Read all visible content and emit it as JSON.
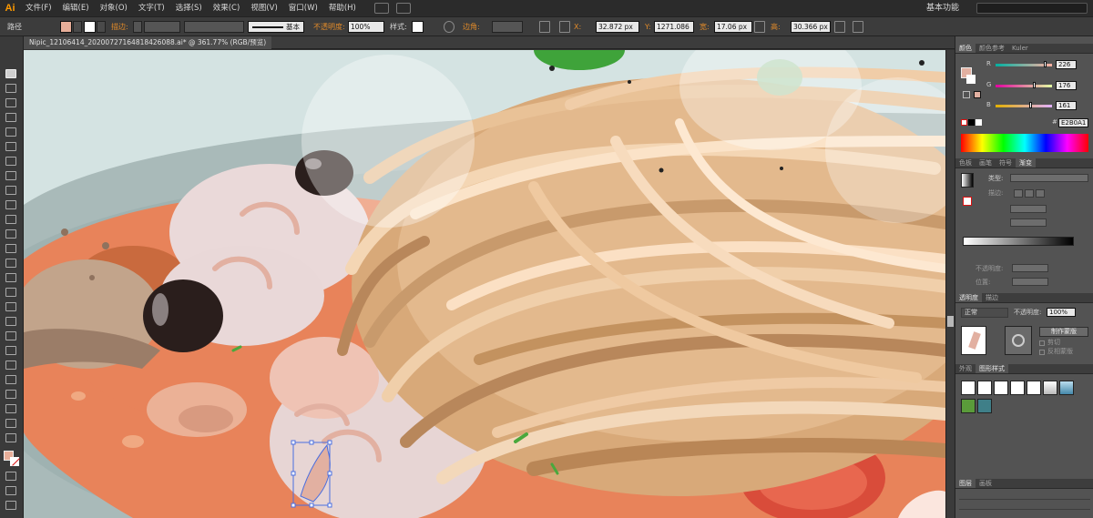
{
  "app": {
    "logo": "Ai",
    "workspace": "基本功能"
  },
  "menu": [
    "文件(F)",
    "编辑(E)",
    "对象(O)",
    "文字(T)",
    "选择(S)",
    "效果(C)",
    "视图(V)",
    "窗口(W)",
    "帮助(H)"
  ],
  "control": {
    "object_type": "路径",
    "stroke_label": "描边:",
    "brush_label": "基本",
    "opacity_label": "不透明度:",
    "opacity_value": "100%",
    "style_label": "样式:",
    "corner_label": "边角:",
    "x_label": "X:",
    "x_value": "32.872 px",
    "y_label": "Y:",
    "y_value": "1271.086",
    "w_label": "宽:",
    "w_value": "17.06 px",
    "h_label": "高:",
    "h_value": "30.366 px",
    "fill_color": "#e7ae99"
  },
  "document": {
    "tab_title": "Nipic_12106414_20200727164818426088.ai* @ 361.77% (RGB/预览)"
  },
  "color_panel": {
    "tabs": [
      "颜色",
      "颜色参考",
      "Kuler"
    ],
    "r_label": "R",
    "r_value": "226",
    "g_label": "G",
    "g_value": "176",
    "b_label": "B",
    "b_value": "161",
    "hex_value": "E2B0A1",
    "r_fraction": 0.886,
    "g_fraction": 0.69,
    "b_fraction": 0.631
  },
  "gradient_panel": {
    "tabs": [
      "色板",
      "画笔",
      "符号",
      "渐变"
    ],
    "type_label": "类型:",
    "stroke_label": "描边:",
    "opacity_label": "不透明度:",
    "position_label": "位置:"
  },
  "transparency_panel": {
    "tabs": [
      "透明度",
      "描边"
    ],
    "blend_mode": "正常",
    "opacity_label": "不透明度:",
    "opacity_value": "100%",
    "make_mask_label": "制作蒙版",
    "clip_label": "剪切",
    "invert_label": "反相蒙版"
  },
  "graphic_styles_panel": {
    "tabs": [
      "外观",
      "图形样式"
    ]
  },
  "layers_panel": {
    "tabs": [
      "图层",
      "画板"
    ]
  },
  "colors": {
    "accent": "#ff9a00",
    "selection": "#4a6ee0",
    "sauce": "#e8835a",
    "pasta": "#e7c6a2"
  }
}
